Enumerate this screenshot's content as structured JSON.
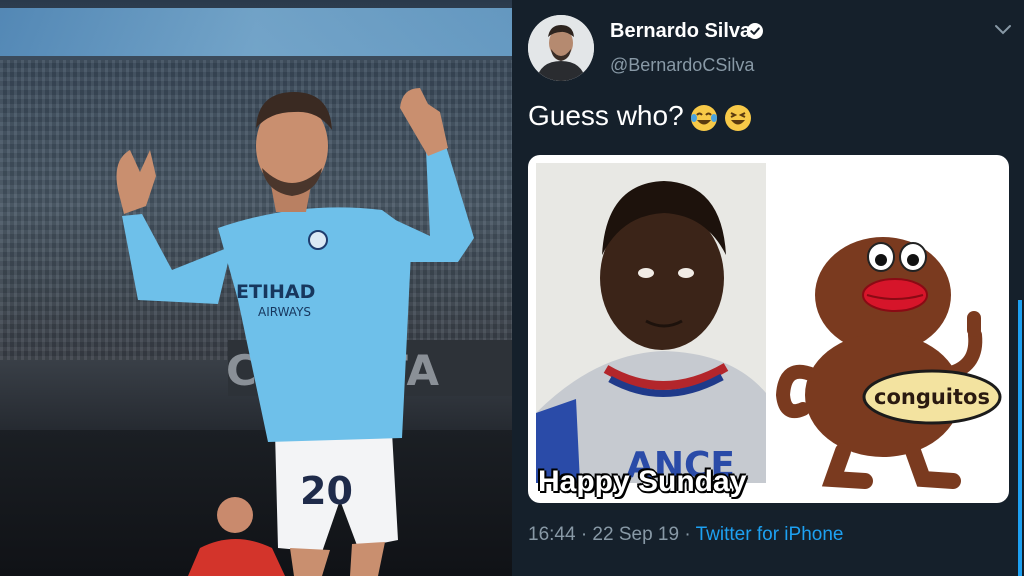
{
  "tweet": {
    "author_name": "Bernardo Silva",
    "handle": "@BernardoCSilva",
    "text": "Guess who?",
    "emojis": [
      "face-with-tears-of-joy",
      "grinning-squinting-face"
    ],
    "media_caption": "Happy Sunday",
    "brand_label": "conguitos",
    "shirt_lettering": "ANCE",
    "timestamp": "16:44 · 22 Sep 19",
    "separator": " · ",
    "source": "Twitter for iPhone"
  },
  "photo": {
    "shirt_number": "20",
    "sponsor_line1": "ETIHAD",
    "sponsor_line2": "AIRWAYS",
    "stand_sign": "CAD STA"
  },
  "colors": {
    "background": "#15202b",
    "secondary_text": "#8899a6",
    "link": "#1da1f2",
    "jersey": "#6ec0ea"
  }
}
